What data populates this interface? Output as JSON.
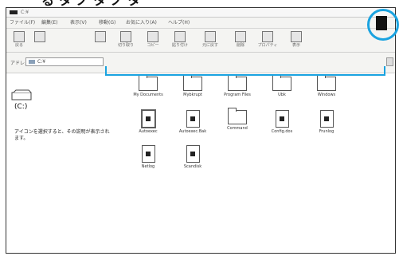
{
  "heading": {
    "text": "るタノタノタ"
  },
  "window": {
    "title": "C:¥",
    "menu": [
      "ファイル(F)",
      "編集(E)",
      "表示(V)",
      "移動(G)",
      "お気に入り(A)",
      "ヘルプ(H)"
    ],
    "toolbar": [
      {
        "label": "戻る",
        "icon": "back-icon"
      },
      {
        "label": "",
        "icon": "forward-icon"
      },
      {
        "label": "",
        "icon": "up-icon"
      },
      {
        "label": "切り取り",
        "icon": "cut-icon"
      },
      {
        "label": "コピー",
        "icon": "copy-icon"
      },
      {
        "label": "貼り付け",
        "icon": "paste-icon"
      },
      {
        "label": "元に戻す",
        "icon": "undo-icon"
      },
      {
        "label": "削除",
        "icon": "delete-icon"
      },
      {
        "label": "プロパティ",
        "icon": "properties-icon"
      },
      {
        "label": "表示",
        "icon": "views-icon"
      }
    ],
    "address": {
      "label": "アドレス(D)",
      "value": "C:¥"
    },
    "left": {
      "drive": "(C:)",
      "text": "アイコンを選択すると、その説明が表示されます。"
    },
    "items": [
      {
        "name": "My Documents",
        "type": "folder"
      },
      {
        "name": "Mybkrupt",
        "type": "folder"
      },
      {
        "name": "Program Files",
        "type": "folder"
      },
      {
        "name": "Ubk",
        "type": "folder"
      },
      {
        "name": "Windows",
        "type": "folder"
      },
      {
        "name": "Autoexec",
        "type": "doc"
      },
      {
        "name": "Autoexec.Bak",
        "type": "doc"
      },
      {
        "name": "Command",
        "type": "window"
      },
      {
        "name": "Config.dos",
        "type": "doc"
      },
      {
        "name": "Frunlog",
        "type": "doc"
      },
      {
        "name": "Netlog",
        "type": "doc"
      },
      {
        "name": "Scandisk",
        "type": "doc"
      }
    ]
  },
  "colors": {
    "accent": "#1aa3e0"
  }
}
